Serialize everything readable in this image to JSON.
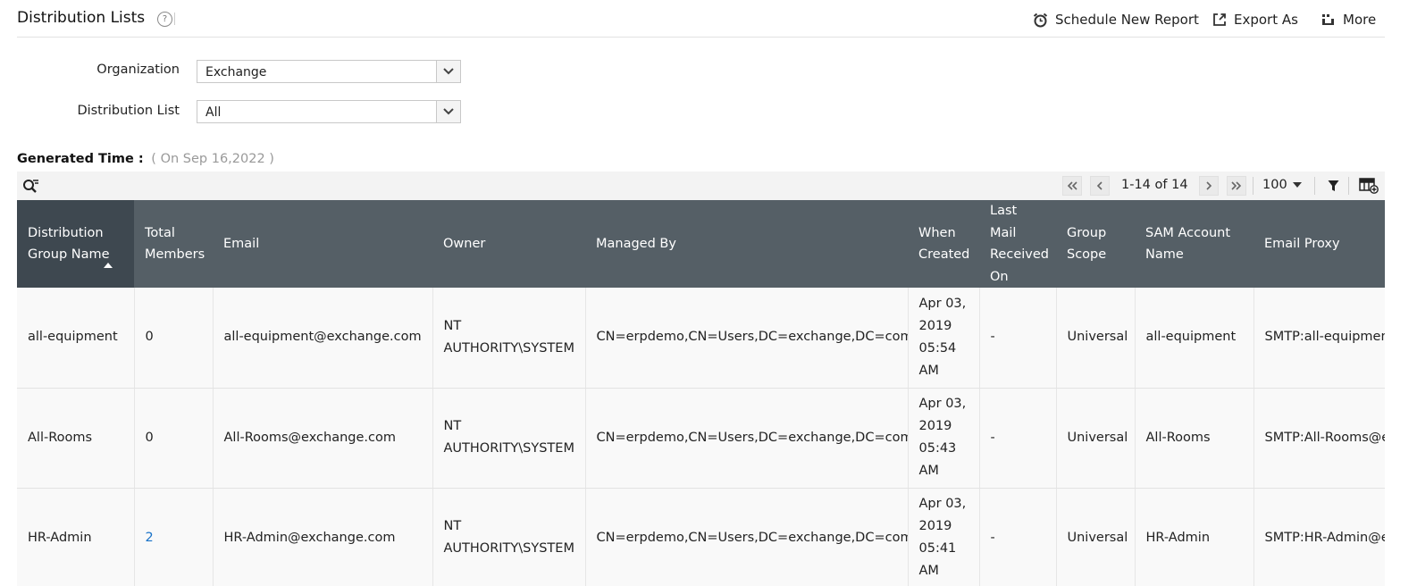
{
  "header": {
    "title": "Distribution Lists",
    "help_icon": "?",
    "actions": {
      "schedule": "Schedule New Report",
      "export": "Export As",
      "more": "More"
    }
  },
  "filters": {
    "organization": {
      "label": "Organization",
      "value": "Exchange"
    },
    "distribution_list": {
      "label": "Distribution List",
      "value": "All"
    }
  },
  "generated": {
    "label": "Generated Time :",
    "value": "( On Sep 16,2022 )"
  },
  "toolbar": {
    "page_info": "1-14 of 14",
    "per_page": "100"
  },
  "table": {
    "columns": [
      "Distribution Group Name",
      "Total Members",
      "Email",
      "Owner",
      "Managed By",
      "When Created",
      "Last Mail Received On",
      "Group Scope",
      "SAM Account Name",
      "Email Proxy"
    ],
    "rows": [
      {
        "name": "all-equipment",
        "members": "0",
        "email": "all-equipment@exchange.com",
        "owner": "NT AUTHORITY\\SYSTEM",
        "managed_by": "CN=erpdemo,CN=Users,DC=exchange,DC=com",
        "created": "Apr 03, 2019 05:54 AM",
        "last_mail": "-",
        "scope": "Universal",
        "sam": "all-equipment",
        "proxy": "SMTP:all-equipment@exchange.com"
      },
      {
        "name": "All-Rooms",
        "members": "0",
        "email": "All-Rooms@exchange.com",
        "owner": "NT AUTHORITY\\SYSTEM",
        "managed_by": "CN=erpdemo,CN=Users,DC=exchange,DC=com",
        "created": "Apr 03, 2019 05:43 AM",
        "last_mail": "-",
        "scope": "Universal",
        "sam": "All-Rooms",
        "proxy": "SMTP:All-Rooms@exchange.com"
      },
      {
        "name": "HR-Admin",
        "members": "2",
        "email": "HR-Admin@exchange.com",
        "owner": "NT AUTHORITY\\SYSTEM",
        "managed_by": "CN=erpdemo,CN=Users,DC=exchange,DC=com",
        "created": "Apr 03, 2019 05:41 AM",
        "last_mail": "-",
        "scope": "Universal",
        "sam": "HR-Admin",
        "proxy": "SMTP:HR-Admin@exchange.com"
      }
    ]
  },
  "colors": {
    "header_bg": "#555f66",
    "sorted_header_bg": "#3e4850",
    "link": "#1a73c8"
  }
}
